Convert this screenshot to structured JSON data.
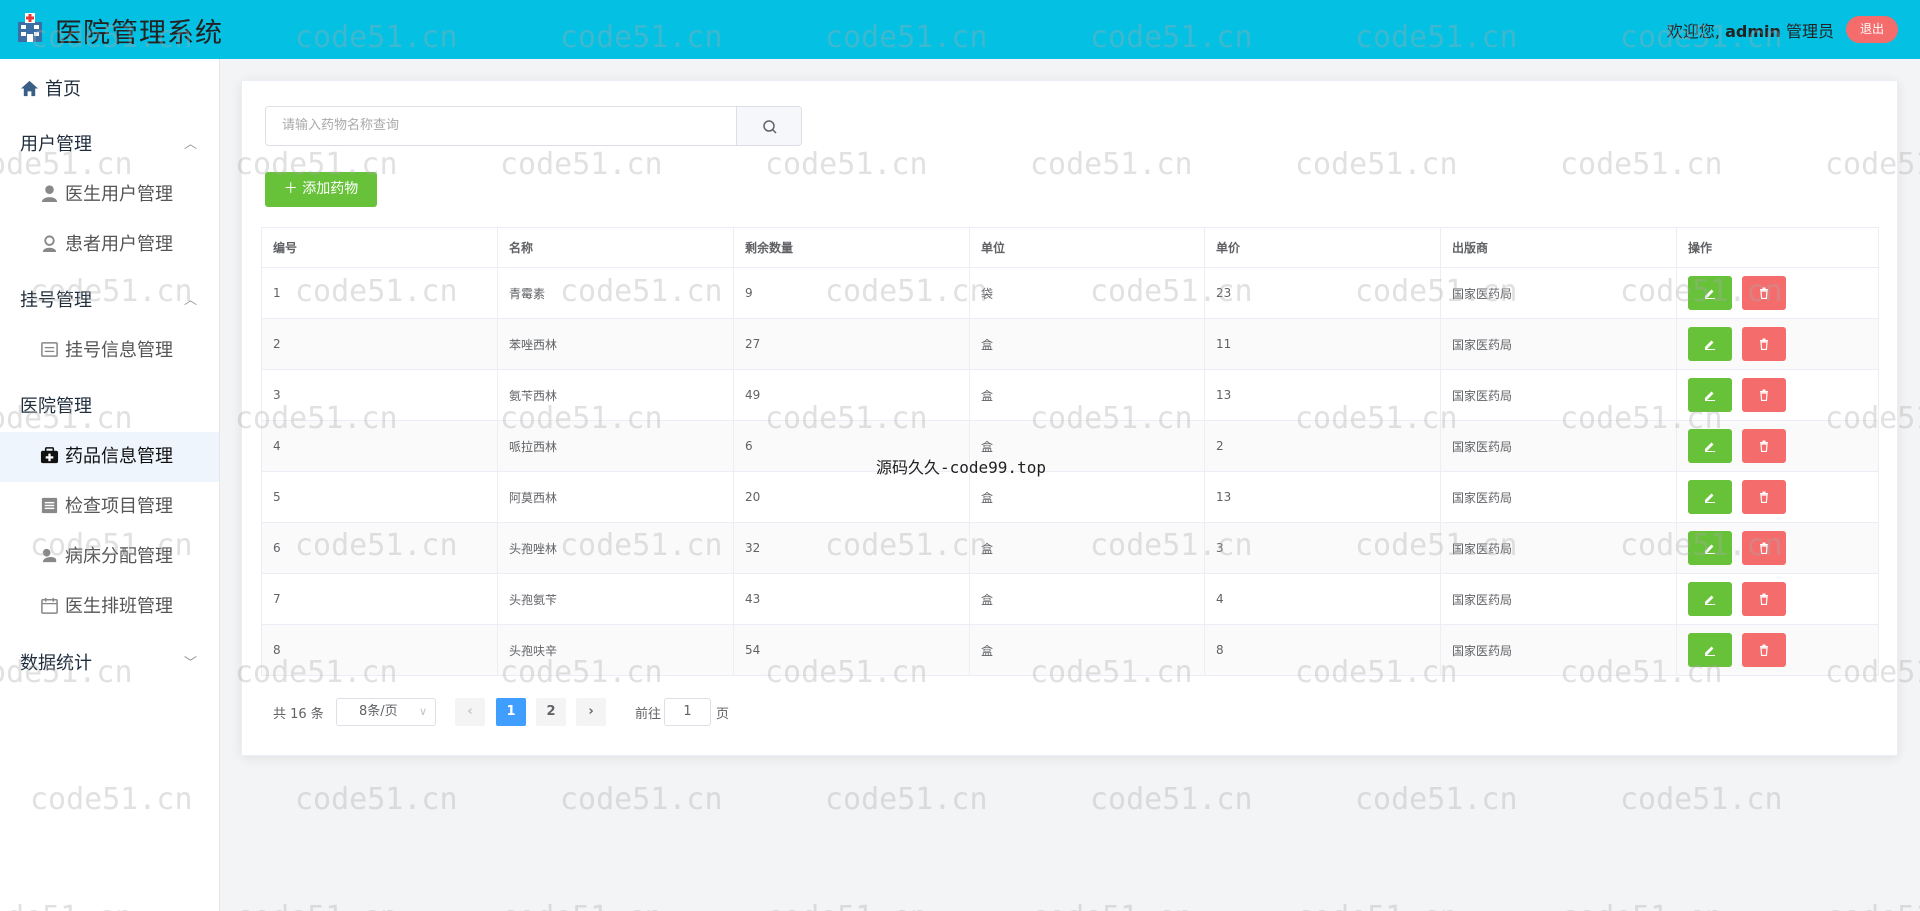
{
  "header": {
    "title": "医院管理系统",
    "welcome_prefix": "欢迎您,",
    "username": "admin",
    "role": "管理员",
    "logout_label": "退出",
    "bg_color": "#04c0e3"
  },
  "sidebar": {
    "home": "首页",
    "groups": [
      {
        "label": "用户管理",
        "expanded": true,
        "items": [
          "医生用户管理",
          "患者用户管理"
        ]
      },
      {
        "label": "挂号管理",
        "expanded": true,
        "items": [
          "挂号信息管理"
        ]
      },
      {
        "label": "医院管理",
        "expanded": true,
        "items": [
          "药品信息管理",
          "检查项目管理",
          "病床分配管理",
          "医生排班管理"
        ]
      },
      {
        "label": "数据统计",
        "expanded": false,
        "items": []
      }
    ],
    "active_item": "药品信息管理"
  },
  "search": {
    "placeholder": "请输入药物名称查询"
  },
  "toolbar": {
    "add_label": "添加药物"
  },
  "table": {
    "columns": [
      "编号",
      "名称",
      "剩余数量",
      "单位",
      "单价",
      "出版商",
      "操作"
    ],
    "rows": [
      [
        "1",
        "青霉素",
        "9",
        "袋",
        "23",
        "国家医药局"
      ],
      [
        "2",
        "苯唑西林",
        "27",
        "盒",
        "11",
        "国家医药局"
      ],
      [
        "3",
        "氨苄西林",
        "49",
        "盒",
        "13",
        "国家医药局"
      ],
      [
        "4",
        "哌拉西林",
        "6",
        "盒",
        "2",
        "国家医药局"
      ],
      [
        "5",
        "阿莫西林",
        "20",
        "盒",
        "13",
        "国家医药局"
      ],
      [
        "6",
        "头孢唑林",
        "32",
        "盒",
        "3",
        "国家医药局"
      ],
      [
        "7",
        "头孢氨苄",
        "43",
        "盒",
        "4",
        "国家医药局"
      ],
      [
        "8",
        "头孢呋辛",
        "54",
        "盒",
        "8",
        "国家医药局"
      ]
    ]
  },
  "pagination": {
    "total_label": "共 16 条",
    "page_size": "8条/页",
    "pages": [
      "1",
      "2"
    ],
    "current_page": "1",
    "goto_label": "前往",
    "goto_value": "1",
    "goto_suffix": "页"
  },
  "watermark": {
    "text": "code51.cn",
    "center_text": "源码久久-code99.top"
  }
}
